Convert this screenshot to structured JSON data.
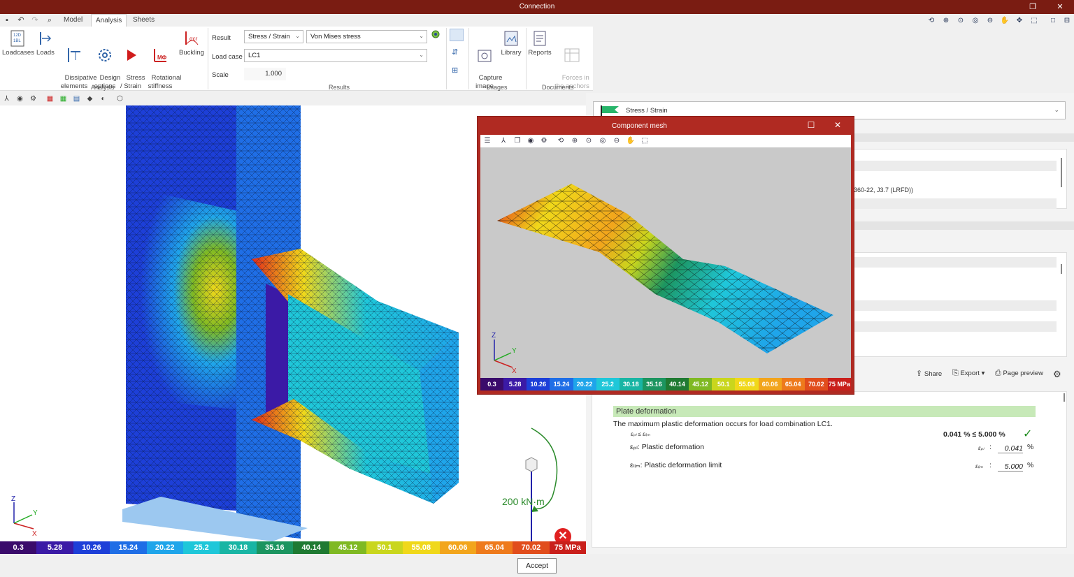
{
  "window": {
    "title": "Connection"
  },
  "menu": {
    "tabs": [
      {
        "label": "Model"
      },
      {
        "label": "Analysis"
      },
      {
        "label": "Sheets"
      }
    ]
  },
  "ribbon": {
    "analysis": {
      "buttons": [
        {
          "label": "Loadcases"
        },
        {
          "label": "Loads"
        },
        {
          "label": "Dissipative\nelements"
        },
        {
          "label": "Design\noptions"
        },
        {
          "label": "Stress\n/ Strain"
        },
        {
          "label": "Rotational\nstiffness"
        },
        {
          "label": "Buckling"
        }
      ],
      "group_label": "Analysis"
    },
    "results": {
      "result_label": "Result",
      "result_value": "Stress / Strain",
      "result_type": "Von Mises stress",
      "loadcase_label": "Load case",
      "loadcase_value": "LC1",
      "scale_label": "Scale",
      "scale_value": "1.000",
      "group_label": "Results"
    },
    "images": {
      "capture_label": "Capture\nimage",
      "library_label": "Library",
      "group_label": "Images"
    },
    "documents": {
      "reports_label": "Reports",
      "forces_label": "Forces in\nthe anchors",
      "group_label": "Documents"
    }
  },
  "legend": {
    "values": [
      "0.3",
      "5.28",
      "10.26",
      "15.24",
      "20.22",
      "25.2",
      "30.18",
      "35.16",
      "40.14",
      "45.12",
      "50.1",
      "55.08",
      "60.06",
      "65.04",
      "70.02",
      "75 MPa"
    ],
    "colors": [
      "#3a0b6b",
      "#3b1aa6",
      "#1d3fd8",
      "#1f6ee6",
      "#1fa5ea",
      "#1fc7d9",
      "#19b5a4",
      "#1c9560",
      "#1f7a32",
      "#7fb923",
      "#c9d61d",
      "#f0d81a",
      "#f2a51c",
      "#ee7a1c",
      "#e14d1c",
      "#c91f1b"
    ]
  },
  "viewport": {
    "moment_label": "200 kN·m"
  },
  "panel": {
    "result_selector": "Stress / Strain",
    "snippet": "360-22, J3.7 (LRFD))",
    "actions": {
      "share": "Share",
      "export": "Export",
      "page_preview": "Page preview"
    },
    "report": {
      "heading": "Plate deformation",
      "sentence": "The maximum plastic deformation occurs for load combination LC1.",
      "check_formula": "εₚₗ ≤ εₗᵢₘ",
      "check_result": "0.041 % ≤ 5.000 %",
      "plastic_label": "εₚₗ: Plastic deformation",
      "plastic_sym": "εₚₗ",
      "plastic_value": "0.041",
      "limit_label": "εₗᵢₘ: Plastic deformation limit",
      "limit_sym": "εₗᵢₘ",
      "limit_value": "5.000",
      "unit": "%"
    }
  },
  "component_window": {
    "title": "Component mesh"
  },
  "footer": {
    "accept": "Accept"
  }
}
